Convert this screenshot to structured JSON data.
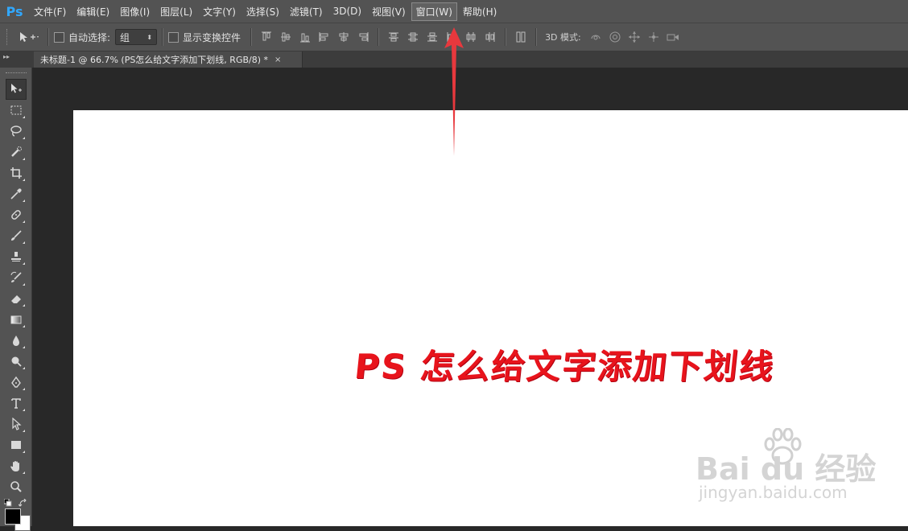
{
  "menubar": {
    "logo": "Ps",
    "items": [
      "文件(F)",
      "编辑(E)",
      "图像(I)",
      "图层(L)",
      "文字(Y)",
      "选择(S)",
      "滤镜(T)",
      "3D(D)",
      "视图(V)",
      "窗口(W)",
      "帮助(H)"
    ],
    "active_item": "窗口(W)"
  },
  "options": {
    "auto_select_label": "自动选择:",
    "auto_select_checked": false,
    "auto_select_value": "组",
    "transform_controls_label": "显示变换控件",
    "transform_controls_checked": false,
    "mode_3d_label": "3D 模式:"
  },
  "document": {
    "tab_title": "未标题-1 @ 66.7% (PS怎么给文字添加下划线, RGB/8) *",
    "close_glyph": "×"
  },
  "tools": [
    "move-tool",
    "marquee-tool",
    "lasso-tool",
    "quick-selection-tool",
    "crop-tool",
    "eyedropper-tool",
    "healing-brush-tool",
    "brush-tool",
    "clone-stamp-tool",
    "history-brush-tool",
    "eraser-tool",
    "gradient-tool",
    "blur-tool",
    "dodge-tool",
    "pen-tool",
    "type-tool",
    "path-selection-tool",
    "rectangle-tool",
    "hand-tool",
    "zoom-tool"
  ],
  "canvas": {
    "headline": "PS 怎么给文字添加下划线",
    "headline_color": "#e8141c"
  },
  "annotation": {
    "arrow_color": "#e8383d"
  },
  "watermark": {
    "brand": "Bai  du 经验",
    "url": "jingyan.baidu.com"
  },
  "colors": {
    "foreground": "#000000",
    "background": "#ffffff",
    "accent": "#31a8ff"
  }
}
